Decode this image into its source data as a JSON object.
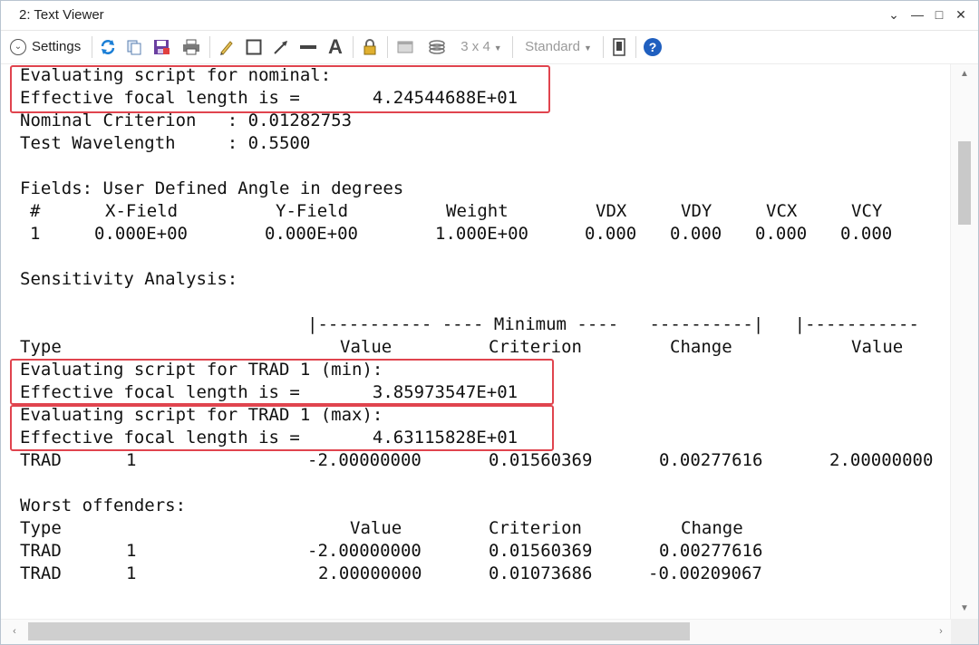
{
  "window": {
    "title": "2: Text Viewer"
  },
  "toolbar": {
    "settings_label": "Settings",
    "grid_label": "3 x 4",
    "style_label": "Standard"
  },
  "icons": {
    "refresh": "refresh-icon",
    "copy": "copy-icon",
    "save": "save-icon",
    "print": "print-icon",
    "pencil": "pencil-icon",
    "rectangle": "rectangle-icon",
    "arrow": "arrow-icon",
    "line": "line-icon",
    "text": "text-icon",
    "lock": "lock-icon",
    "window": "window-icon",
    "layers": "layers-icon",
    "device": "device-icon",
    "help": "help-icon"
  },
  "highlight_color": "#e0444e",
  "report": {
    "nominal_eval": "Evaluating script for nominal:",
    "nominal_efl": "Effective focal length is =       4.24544688E+01",
    "nominal_criterion": "Nominal Criterion   : 0.01282753",
    "test_wavelength": "Test Wavelength     : 0.5500",
    "fields_title": "Fields: User Defined Angle in degrees",
    "fields_headers": [
      "#",
      "X-Field",
      "Y-Field",
      "Weight",
      "VDX",
      "VDY",
      "VCX",
      "VCY"
    ],
    "fields_row": [
      "1",
      "0.000E+00",
      "0.000E+00",
      "1.000E+00",
      "0.000",
      "0.000",
      "0.000",
      "0.000"
    ],
    "sensitivity_title": "Sensitivity Analysis:",
    "sens_group_header": "|----------- ---- Minimum ----   ----------|   |-----------",
    "sens_headers": [
      "Type",
      "Value",
      "Criterion",
      "Change",
      "Value"
    ],
    "trad_min_eval": "Evaluating script for TRAD 1 (min):",
    "trad_min_efl": "Effective focal length is =       3.85973547E+01",
    "trad_max_eval": "Evaluating script for TRAD 1 (max):",
    "trad_max_efl": "Effective focal length is =       4.63115828E+01",
    "sens_row": [
      "TRAD",
      "1",
      "-2.00000000",
      "0.01560369",
      "0.00277616",
      "2.00000000"
    ],
    "worst_title": "Worst offenders:",
    "worst_headers": [
      "Type",
      "Value",
      "Criterion",
      "Change"
    ],
    "worst_rows": [
      [
        "TRAD",
        "1",
        "-2.00000000",
        "0.01560369",
        "0.00277616"
      ],
      [
        "TRAD",
        "1",
        "2.00000000",
        "0.01073686",
        "-0.00209067"
      ]
    ]
  }
}
